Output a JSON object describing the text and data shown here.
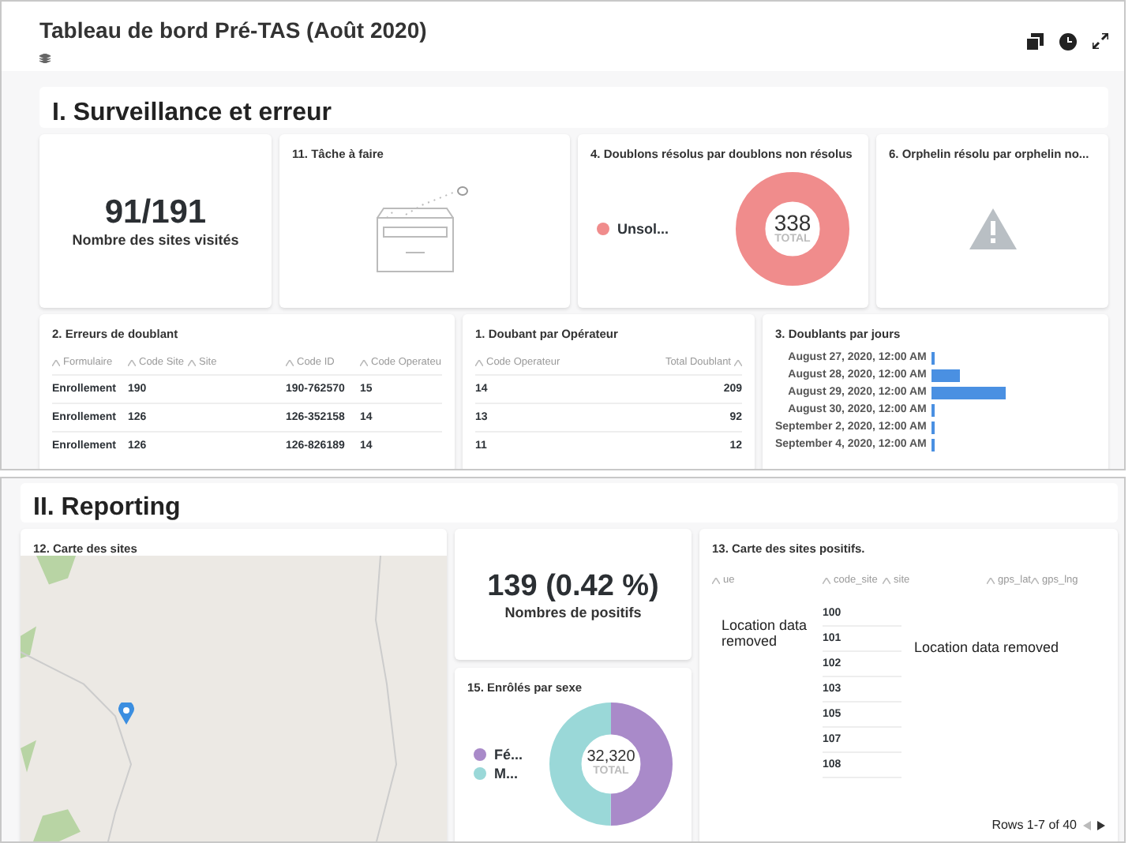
{
  "header": {
    "title": "Tableau de bord Pré-TAS (Août 2020)"
  },
  "section_1": {
    "title": "I. Surveillance et erreur"
  },
  "stat_sites": {
    "value": "91/191",
    "label": "Nombre des sites visités"
  },
  "task_card": {
    "title": "11. Tâche à faire"
  },
  "duplicates_donut": {
    "title": "4. Doublons résolus par doublons non résolus",
    "total": "338",
    "total_label": "TOTAL",
    "legend": [
      {
        "label": "Unsol...",
        "color": "#f08c8c"
      }
    ]
  },
  "orphan_card": {
    "title": "6. Orphelin résolu par orphelin no..."
  },
  "errors_table": {
    "title": "2. Erreurs de doublant",
    "columns": [
      "Formulaire",
      "Code Site",
      "Site",
      "Code ID",
      "Code Operateu"
    ],
    "rows": [
      [
        "Enrollement",
        "190",
        null,
        "190-762570",
        "15"
      ],
      [
        "Enrollement",
        "126",
        null,
        "126-352158",
        "14"
      ],
      [
        "Enrollement",
        "126",
        null,
        "126-826189",
        "14"
      ]
    ]
  },
  "operator_table": {
    "title": "1. Doubant par Opérateur",
    "columns": [
      "Code Operateur",
      "Total Doublant"
    ],
    "rows": [
      [
        "14",
        "209"
      ],
      [
        "13",
        "92"
      ],
      [
        "11",
        "12"
      ]
    ]
  },
  "days_chart": {
    "title": "3. Doublants par jours",
    "bars": [
      {
        "label": "August 27, 2020, 12:00 AM"
      },
      {
        "label": "August 28, 2020, 12:00 AM"
      },
      {
        "label": "August 29, 2020, 12:00 AM"
      },
      {
        "label": "August 30, 2020, 12:00 AM"
      },
      {
        "label": "September 2, 2020, 12:00 AM"
      },
      {
        "label": "September 4, 2020, 12:00 AM"
      }
    ]
  },
  "section_2": {
    "title": "II. Reporting"
  },
  "map_card": {
    "title": "12. Carte des sites"
  },
  "stat_positives": {
    "value": "139 (0.42 %)",
    "label": "Nombres de positifs"
  },
  "sex_donut": {
    "title": "15. Enrôlés par sexe",
    "total": "32,320",
    "total_label": "TOTAL",
    "legend": [
      {
        "label": "Fé...",
        "color": "#a98ac9"
      },
      {
        "label": "M...",
        "color": "#9ad8d8"
      }
    ]
  },
  "positives_table": {
    "title": "13. Carte des sites positifs.",
    "columns": [
      "ue",
      "code_site",
      "site",
      "gps_lat",
      "gps_lng"
    ],
    "code_site": [
      "100",
      "101",
      "102",
      "103",
      "105",
      "107",
      "108"
    ],
    "note_left": "Location data removed",
    "note_right": "Location data removed",
    "pagination": "Rows 1-7 of 40"
  }
}
